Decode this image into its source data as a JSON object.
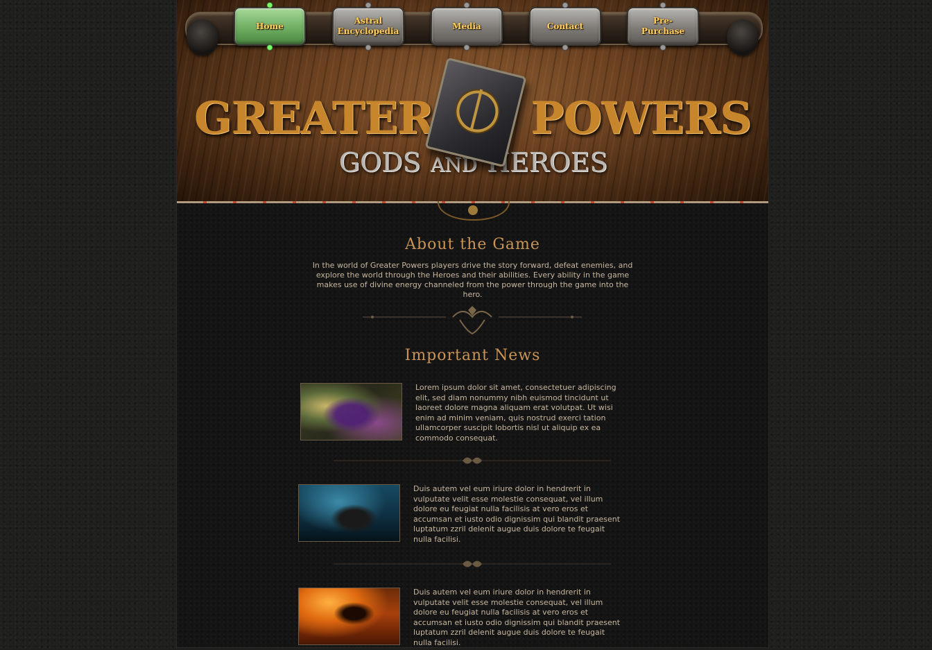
{
  "nav": {
    "items": [
      {
        "label": "Home",
        "active": true
      },
      {
        "label": "Astral Encyclopedia",
        "active": false
      },
      {
        "label": "Media",
        "active": false
      },
      {
        "label": "Contact",
        "active": false
      },
      {
        "label": "Pre-Purchase",
        "active": false
      }
    ]
  },
  "header": {
    "title_left": "GREATER",
    "title_right": "POWERS",
    "subtitle_gods": "GODS",
    "subtitle_and": "AND",
    "subtitle_heroes": "HEROES",
    "book_icon": "spell-book-icon"
  },
  "about": {
    "heading": "About the Game",
    "text": "In the world of Greater Powers players drive the story forward, defeat enemies, and explore the world through the Heroes and their abilities. Every ability in the game makes use of divine energy channeled from the power through the game into the hero."
  },
  "news": {
    "heading": "Important News",
    "items": [
      {
        "text": "Lorem ipsum dolor sit amet, consectetuer adipiscing elit, sed diam nonummy nibh euismod tincidunt ut laoreet dolore magna aliquam erat volutpat. Ut wisi enim ad minim veniam, quis nostrud exerci tation ullamcorper suscipit lobortis nisl ut aliquip ex ea commodo consequat."
      },
      {
        "text": "Duis autem vel eum iriure dolor in hendrerit in vulputate velit esse molestie consequat, vel illum dolore eu feugiat nulla facilisis at vero eros et accumsan et iusto odio dignissim qui blandit praesent luptatum zzril delenit augue duis dolore te feugait nulla facilisi."
      },
      {
        "text": "Duis autem vel eum iriure dolor in hendrerit in vulputate velit esse molestie consequat, vel illum dolore eu feugiat nulla facilisis at vero eros et accumsan et iusto odio dignissim qui blandit praesent luptatum zzril delenit augue duis dolore te feugait nulla facilisi."
      }
    ]
  },
  "colors": {
    "accent_gold": "#c99556",
    "body_text": "#c6b79f",
    "nav_text": "#ffd060",
    "active_nav": "#6fae62"
  }
}
